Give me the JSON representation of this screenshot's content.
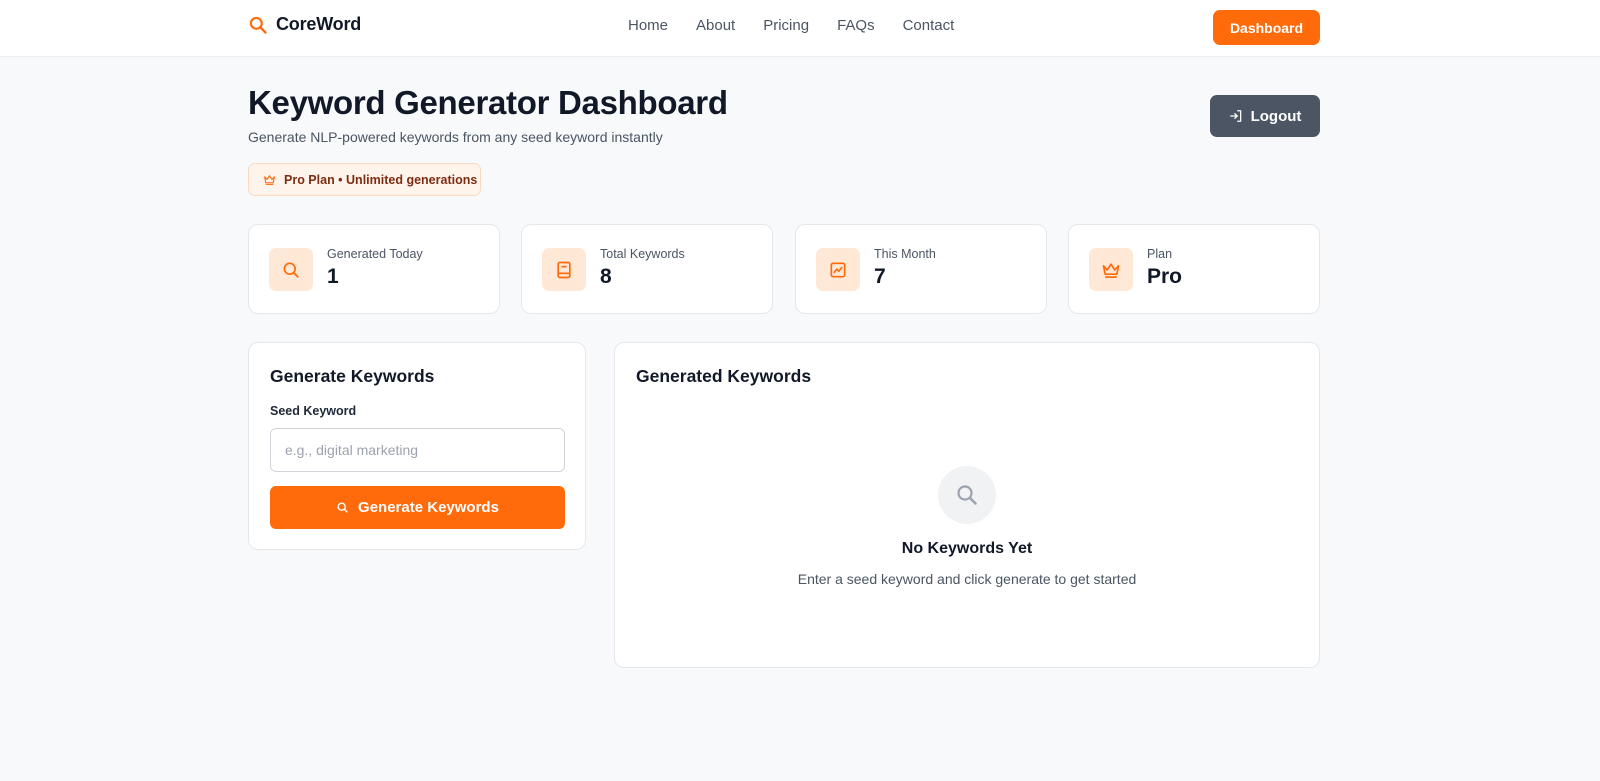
{
  "header": {
    "brand": "CoreWord",
    "nav": [
      "Home",
      "About",
      "Pricing",
      "FAQs",
      "Contact"
    ],
    "dashboard_label": "Dashboard"
  },
  "page": {
    "title": "Keyword Generator Dashboard",
    "subtitle": "Generate NLP-powered keywords from any seed keyword instantly",
    "plan_badge": "Pro Plan • Unlimited generations",
    "logout_label": "Logout"
  },
  "stats": [
    {
      "label": "Generated Today",
      "value": "1",
      "icon": "search-icon"
    },
    {
      "label": "Total Keywords",
      "value": "8",
      "icon": "book-icon"
    },
    {
      "label": "This Month",
      "value": "7",
      "icon": "chart-icon"
    },
    {
      "label": "Plan",
      "value": "Pro",
      "icon": "crown-icon"
    }
  ],
  "generate": {
    "title": "Generate Keywords",
    "field_label": "Seed Keyword",
    "placeholder": "e.g., digital marketing",
    "value": "",
    "button_label": "Generate Keywords"
  },
  "results": {
    "title": "Generated Keywords",
    "empty_title": "No Keywords Yet",
    "empty_subtitle": "Enter a seed keyword and click generate to get started"
  },
  "colors": {
    "accent": "#ff6a0a",
    "accent_soft": "#ffe8d6",
    "logout_bg": "#4b5563"
  }
}
